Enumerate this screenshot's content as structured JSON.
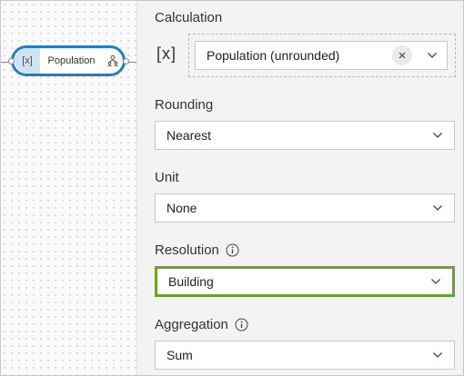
{
  "node": {
    "badge": "[x]",
    "label": "Population",
    "icon": "population-icon",
    "accent": "#1f7fc2"
  },
  "panel": {
    "calculation": {
      "label": "Calculation",
      "var_icon": "[x]",
      "value": "Population (unrounded)"
    },
    "rounding": {
      "label": "Rounding",
      "value": "Nearest"
    },
    "unit": {
      "label": "Unit",
      "value": "None"
    },
    "resolution": {
      "label": "Resolution",
      "value": "Building",
      "highlight": "#6aa32c"
    },
    "aggregation": {
      "label": "Aggregation",
      "value": "Sum"
    }
  }
}
